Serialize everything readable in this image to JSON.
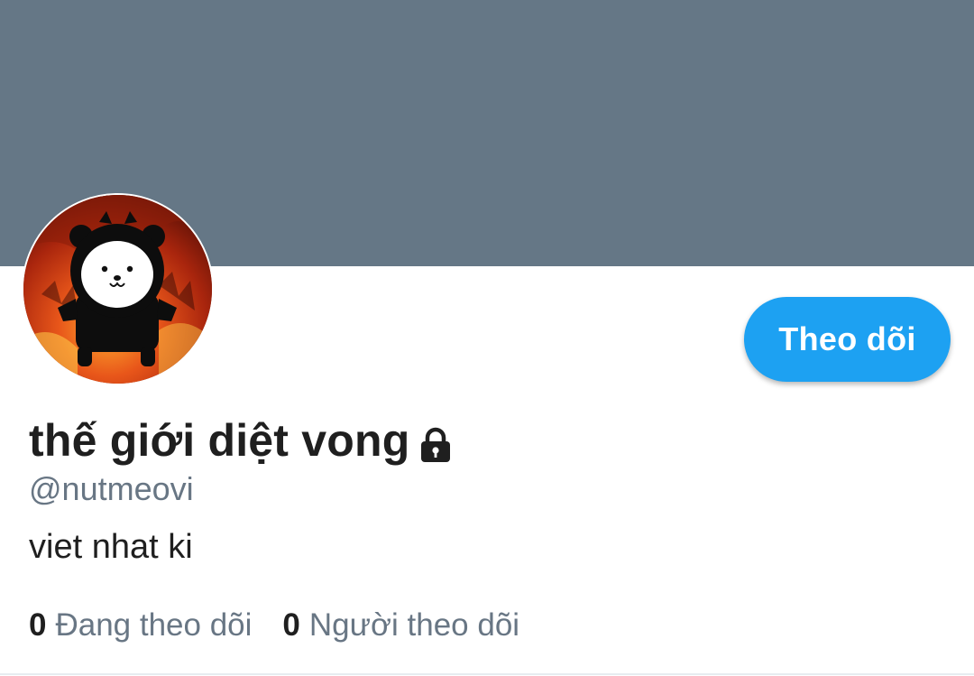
{
  "profile": {
    "display_name": "thế giới diệt vong",
    "handle": "@nutmeovi",
    "bio": "viet nhat ki",
    "protected_icon": "lock-icon",
    "avatar_icon": "avatar-bear-icon"
  },
  "actions": {
    "follow_label": "Theo dõi"
  },
  "stats": {
    "following_count": "0",
    "following_label": "Đang theo dõi",
    "followers_count": "0",
    "followers_label": "Người theo dõi"
  },
  "colors": {
    "banner": "#657786",
    "accent": "#1da1f2",
    "text_primary": "#1f1f1f",
    "text_secondary": "#687684"
  }
}
